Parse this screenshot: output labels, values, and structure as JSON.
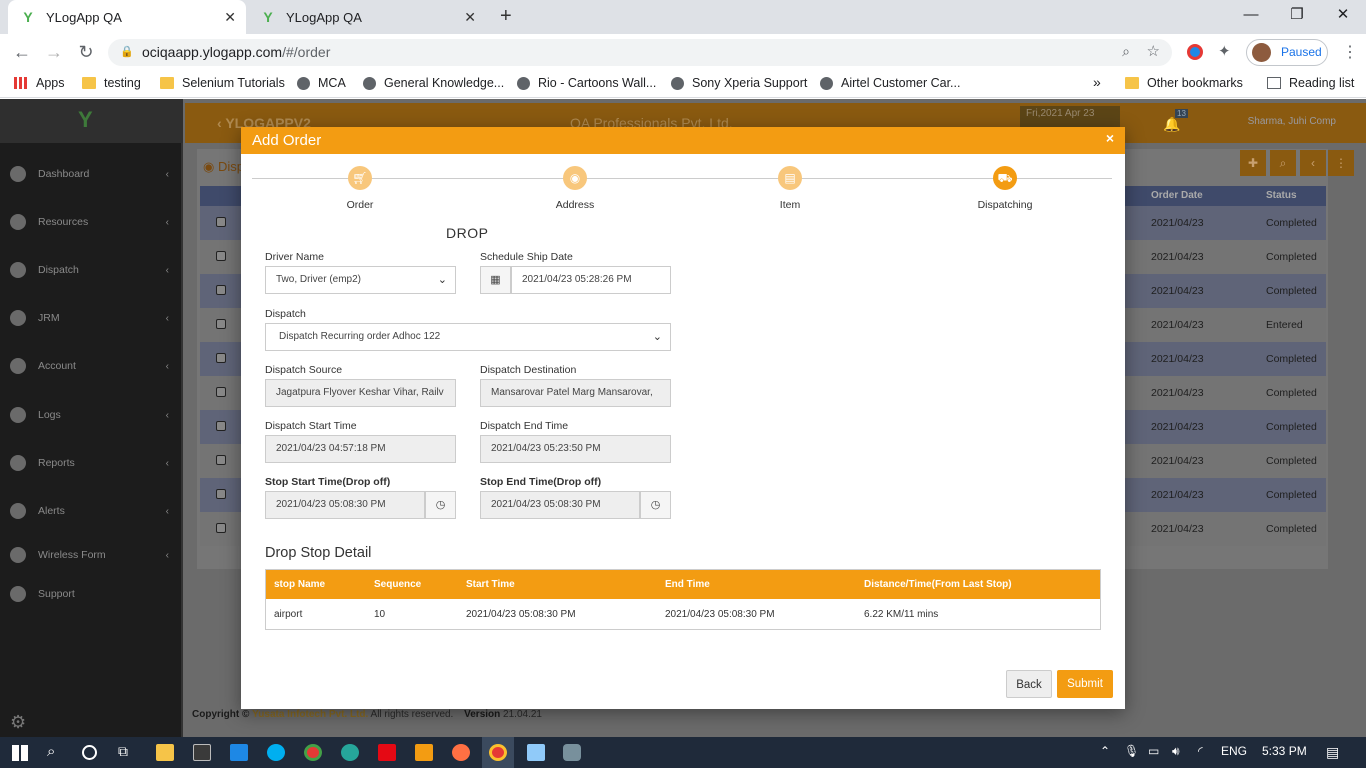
{
  "browser": {
    "tabs": [
      {
        "title": "YLogApp QA",
        "active": true
      },
      {
        "title": "YLogApp QA",
        "active": false
      }
    ],
    "url_host": "ociqaapp.ylogapp.com",
    "url_path": "/#/order",
    "profile_status": "Paused",
    "bookmarks": [
      {
        "label": "Apps",
        "icon": "apps-grid-icon"
      },
      {
        "label": "testing",
        "icon": "folder-icon"
      },
      {
        "label": "Selenium Tutorials",
        "icon": "folder-icon"
      },
      {
        "label": "MCA",
        "icon": "globe-icon"
      },
      {
        "label": "General Knowledge...",
        "icon": "globe-icon"
      },
      {
        "label": "Rio - Cartoons Wall...",
        "icon": "globe-icon"
      },
      {
        "label": "Sony Xperia Support",
        "icon": "globe-icon"
      },
      {
        "label": "Airtel Customer Car...",
        "icon": "globe-icon"
      }
    ],
    "more_bookmarks": "»",
    "other_bookmarks": "Other bookmarks",
    "reading_list": "Reading list"
  },
  "app": {
    "topbar": {
      "brand": "YLOGAPPV2",
      "company": "QA Professionals Pvt. Ltd.",
      "datetime": "Fri,2021 Apr 23",
      "user": "Sharma, Juhi Comp",
      "notification_count": "13"
    },
    "sidebar": [
      {
        "label": "Dashboard"
      },
      {
        "label": "Resources"
      },
      {
        "label": "Dispatch"
      },
      {
        "label": "JRM"
      },
      {
        "label": "Account"
      },
      {
        "label": "Logs"
      },
      {
        "label": "Reports"
      },
      {
        "label": "Alerts"
      },
      {
        "label": "Wireless Form"
      },
      {
        "label": "Support"
      }
    ],
    "page_title": "Disp",
    "background_table": {
      "headers": {
        "order_date": "Order Date",
        "status": "Status"
      },
      "rows": [
        {
          "date": "2021/04/23",
          "status": "Completed"
        },
        {
          "date": "2021/04/23",
          "status": "Completed"
        },
        {
          "date": "2021/04/23",
          "status": "Completed"
        },
        {
          "date": "2021/04/23",
          "status": "Entered"
        },
        {
          "date": "2021/04/23",
          "status": "Completed"
        },
        {
          "date": "2021/04/23",
          "status": "Completed"
        },
        {
          "date": "2021/04/23",
          "status": "Completed"
        },
        {
          "date": "2021/04/23",
          "status": "Completed"
        },
        {
          "date": "2021/04/23",
          "status": "Completed"
        },
        {
          "date": "2021/04/23",
          "status": "Completed"
        }
      ]
    },
    "footer": {
      "copyright": "Copyright ©",
      "company": "Yusata Infotech Pvt. Ltd.",
      "rights": "All rights reserved.",
      "version_label": "Version",
      "version": "21.04.21"
    }
  },
  "modal": {
    "title": "Add Order",
    "close": "×",
    "steps": [
      {
        "label": "Order",
        "icon": "cart-icon"
      },
      {
        "label": "Address",
        "icon": "map-pin-icon"
      },
      {
        "label": "Item",
        "icon": "item-card-icon"
      },
      {
        "label": "Dispatching",
        "icon": "truck-icon"
      }
    ],
    "section_title": "DROP",
    "fields": {
      "driver_name": {
        "label": "Driver Name",
        "value": "Two, Driver (emp2)"
      },
      "schedule_ship_date": {
        "label": "Schedule Ship Date",
        "value": "2021/04/23 05:28:26 PM"
      },
      "dispatch": {
        "label": "Dispatch",
        "value": "Dispatch Recurring order Adhoc 122"
      },
      "dispatch_source": {
        "label": "Dispatch Source",
        "value": "Jagatpura Flyover Keshar Vihar, Railv"
      },
      "dispatch_destination": {
        "label": "Dispatch Destination",
        "value": "Mansarovar Patel Marg Mansarovar,"
      },
      "dispatch_start_time": {
        "label": "Dispatch Start Time",
        "value": "2021/04/23 04:57:18 PM"
      },
      "dispatch_end_time": {
        "label": "Dispatch End Time",
        "value": "2021/04/23 05:23:50 PM"
      },
      "stop_start_time": {
        "label": "Stop Start Time(Drop off)",
        "value": "2021/04/23 05:08:30 PM"
      },
      "stop_end_time": {
        "label": "Stop End Time(Drop off)",
        "value": "2021/04/23 05:08:30 PM"
      }
    },
    "drop_stop_detail": {
      "title": "Drop Stop Detail",
      "headers": [
        "stop Name",
        "Sequence",
        "Start Time",
        "End Time",
        "Distance/Time(From Last Stop)"
      ],
      "rows": [
        [
          "airport",
          "10",
          "2021/04/23 05:08:30 PM",
          "2021/04/23 05:08:30 PM",
          "6.22 KM/11 mins"
        ]
      ]
    },
    "buttons": {
      "back": "Back",
      "submit": "Submit"
    }
  },
  "taskbar": {
    "language": "ENG",
    "time": "5:33 PM"
  },
  "colors": {
    "accent": "#f39c12",
    "accent_light": "#f8c77c",
    "sidebar": "#1c1c1c"
  }
}
